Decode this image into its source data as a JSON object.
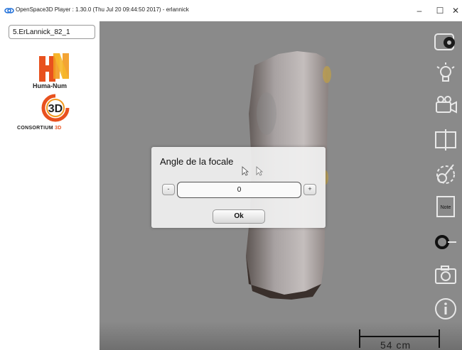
{
  "window": {
    "title": "OpenSpace3D Player : 1.30.0 (Thu Jul 20 09:44:50 2017) - erlannick",
    "minimize": "–",
    "maximize": "☐",
    "close": "✕"
  },
  "sidebar": {
    "scene_name": "5.ErLannick_82_1",
    "logo1_label": "Huma-Num",
    "logo2_label_main": "CONSORTIUM ",
    "logo2_label_accent": "3D",
    "logo2_text": "3D"
  },
  "dialog": {
    "title": "Angle de la focale",
    "decrement": "-",
    "increment": "+",
    "value": "0",
    "ok_label": "Ok"
  },
  "toolbar": {
    "items": [
      "settings-icon",
      "lightbulb-icon",
      "camera-icon",
      "section-plane-icon",
      "rotate-icon",
      "note-icon",
      "measure-tape-icon",
      "screenshot-icon",
      "info-icon"
    ],
    "note_label": "Note"
  },
  "scale": {
    "label": "54 cm"
  },
  "colors": {
    "accent_red": "#e8511e",
    "viewport_bg": "#8a8a8a"
  }
}
